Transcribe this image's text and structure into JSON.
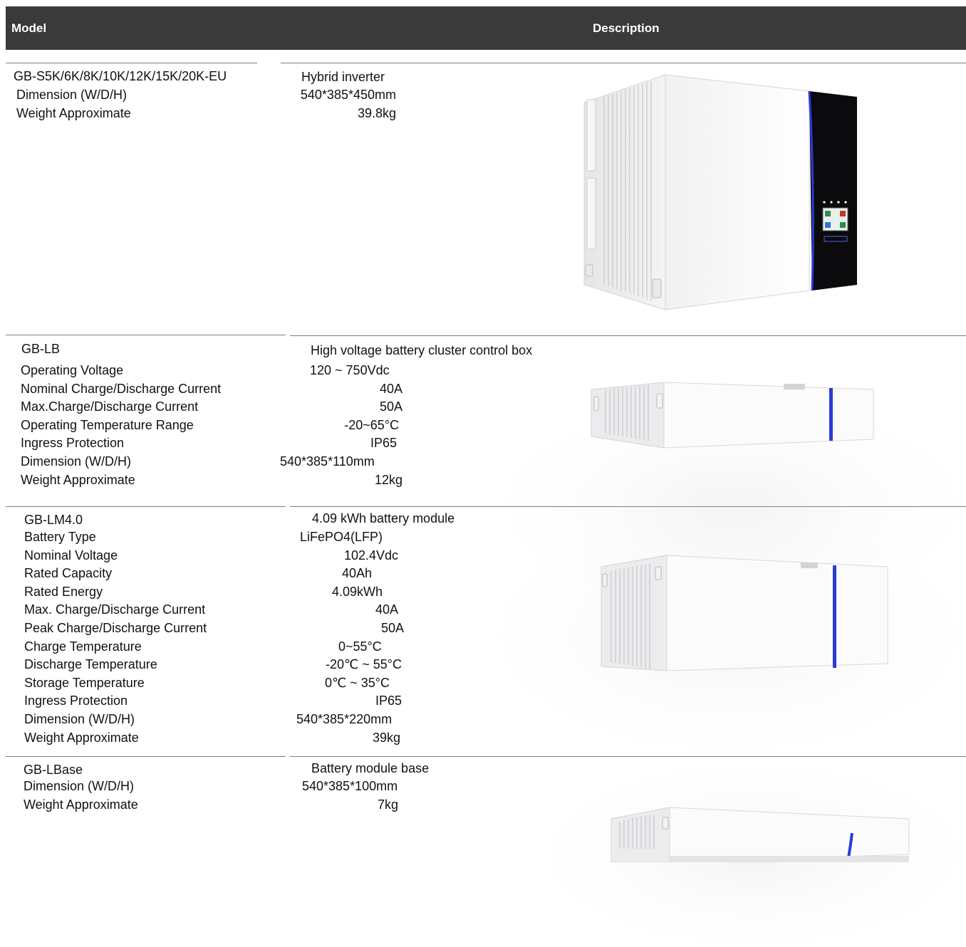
{
  "header": {
    "model": "Model",
    "description": "Description"
  },
  "sections": [
    {
      "model": "GB-S5K/6K/8K/10K/12K/15K/20K-EU",
      "title": "Hybrid inverter",
      "specs": [
        {
          "label": "Dimension (W/D/H)",
          "value": "540*385*450mm"
        },
        {
          "label": "Weight Approximate",
          "value": "39.8kg"
        }
      ],
      "image_icon": "hybrid-inverter-image"
    },
    {
      "model": "GB-LB",
      "title": "High voltage battery cluster control box",
      "specs": [
        {
          "label": "Operating Voltage",
          "value": "120 ~ 750Vdc"
        },
        {
          "label": "Nominal Charge/Discharge Current",
          "value": "40A"
        },
        {
          "label": "Max.Charge/Discharge Current",
          "value": "50A"
        },
        {
          "label": "Operating Temperature Range",
          "value": "-20~65°C"
        },
        {
          "label": "Ingress Protection",
          "value": "IP65"
        },
        {
          "label": "Dimension (W/D/H)",
          "value": "540*385*110mm"
        },
        {
          "label": "Weight Approximate",
          "value": "12kg"
        }
      ],
      "image_icon": "control-box-image"
    },
    {
      "model": "GB-LM4.0",
      "title": "4.09 kWh battery module",
      "specs": [
        {
          "label": "Battery Type",
          "value": "LiFePO4(LFP)"
        },
        {
          "label": "Nominal Voltage",
          "value": "102.4Vdc"
        },
        {
          "label": "Rated Capacity",
          "value": "40Ah"
        },
        {
          "label": "Rated Energy",
          "value": "4.09kWh"
        },
        {
          "label": "Max. Charge/Discharge Current",
          "value": "40A"
        },
        {
          "label": "Peak Charge/Discharge Current",
          "value": "50A"
        },
        {
          "label": "Charge Temperature",
          "value": "0~55°C"
        },
        {
          "label": "Discharge Temperature",
          "value": "-20℃ ~ 55°C"
        },
        {
          "label": "Storage Temperature",
          "value": "0℃ ~ 35°C"
        },
        {
          "label": "Ingress Protection",
          "value": "IP65"
        },
        {
          "label": "Dimension (W/D/H)",
          "value": "540*385*220mm"
        },
        {
          "label": "Weight Approximate",
          "value": "39kg"
        }
      ],
      "image_icon": "battery-module-image"
    },
    {
      "model": "GB-LBase",
      "title": "Battery module base",
      "specs": [
        {
          "label": "Dimension (W/D/H)",
          "value": "540*385*100mm"
        },
        {
          "label": "Weight Approximate",
          "value": "7kg"
        }
      ],
      "image_icon": "battery-base-image"
    }
  ],
  "colors": {
    "header_bg": "#3a3a3a",
    "rule": "#7d7d7d",
    "accent_stripe": "#2a3bd6"
  }
}
